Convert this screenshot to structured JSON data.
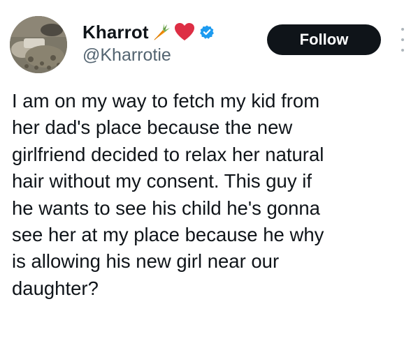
{
  "author": {
    "display_name": "Kharrot",
    "handle": "@Kharrotie",
    "name_emojis": [
      "carrot-icon",
      "red-heart-icon"
    ],
    "verified_icon": "verified-badge-icon",
    "verified_color": "#1d9bf0"
  },
  "actions": {
    "follow_label": "Follow",
    "more_icon": "more-vertical-icon"
  },
  "tweet": {
    "text": "I am on my way to fetch my kid from\nher dad's place because the new\ngirlfriend decided to relax her natural\nhair without my consent. This guy if\nhe wants to see his child he's gonna\nsee her at my place because he why\nis allowing his new girl near our\ndaughter?"
  },
  "colors": {
    "text": "#0f1419",
    "secondary_text": "#536471",
    "follow_bg": "#0f1419",
    "follow_text": "#ffffff"
  }
}
